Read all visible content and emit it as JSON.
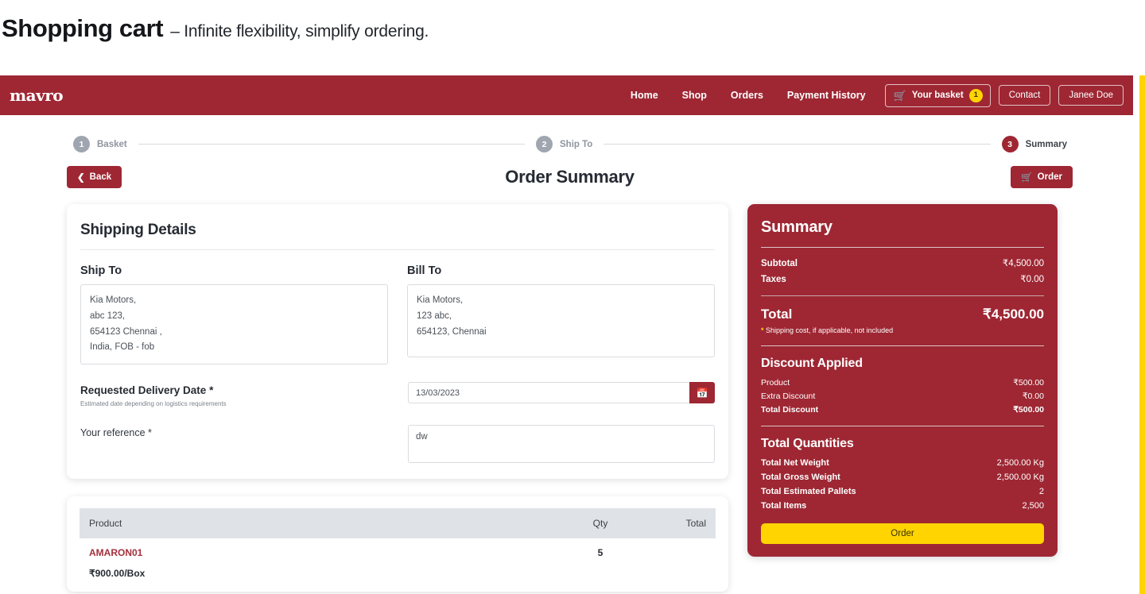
{
  "page": {
    "title": "Shopping cart",
    "subtitle": "– Infinite flexibility, simplify ordering."
  },
  "navbar": {
    "brand": "mavro",
    "links": [
      {
        "label": "Home"
      },
      {
        "label": "Shop"
      },
      {
        "label": "Orders"
      },
      {
        "label": "Payment History"
      }
    ],
    "basket": {
      "label": "Your basket",
      "count": "1",
      "icon": "shopping-cart-icon"
    },
    "contact_label": "Contact",
    "user_label": "Janee Doe",
    "bg_color": "#9E2733"
  },
  "stepper": {
    "steps": [
      {
        "number": "1",
        "label": "Basket",
        "active": false
      },
      {
        "number": "2",
        "label": "Ship To",
        "active": false
      },
      {
        "number": "3",
        "label": "Summary",
        "active": true
      }
    ]
  },
  "toolbar": {
    "back_label": "Back",
    "back_icon": "chevron-left-icon",
    "page_title": "Order Summary",
    "order_label": "Order",
    "order_icon": "shopping-cart-icon"
  },
  "shipping": {
    "card_title": "Shipping Details",
    "ship_to_label": "Ship To",
    "ship_to_address": "Kia Motors,\nabc 123,\n654123 Chennai ,\nIndia, FOB - fob",
    "bill_to_label": "Bill To",
    "bill_to_address": "Kia Motors,\n123 abc,\n654123, Chennai",
    "delivery_date_label": "Requested Delivery Date *",
    "delivery_date_hint": "Estimated date depending on logistics requirements",
    "delivery_date_value": "13/03/2023",
    "calendar_icon": "calendar-icon",
    "reference_label": "Your reference *",
    "reference_value": "dw"
  },
  "products": {
    "headers": {
      "product": "Product",
      "qty": "Qty",
      "total": "Total"
    },
    "rows": [
      {
        "sku": "AMARON01",
        "price": "₹900.00/Box",
        "qty": "5"
      }
    ]
  },
  "summary": {
    "title": "Summary",
    "lines": [
      {
        "label": "Subtotal",
        "value": "₹4,500.00"
      },
      {
        "label": "Taxes",
        "value": "₹0.00"
      }
    ],
    "total_label": "Total",
    "total_value": "₹4,500.00",
    "note_star": "*",
    "note_text": " Shipping cost, if applicable, not included",
    "discount": {
      "title": "Discount Applied",
      "rows": [
        {
          "label": "Product",
          "value": "₹500.00",
          "bold": false
        },
        {
          "label": "Extra Discount",
          "value": "₹0.00",
          "bold": false
        },
        {
          "label": "Total Discount",
          "value": "₹500.00",
          "bold": true
        }
      ]
    },
    "quantities": {
      "title": "Total Quantities",
      "rows": [
        {
          "label": "Total Net Weight",
          "value": "2,500.00 Kg"
        },
        {
          "label": "Total Gross Weight",
          "value": "2,500.00 Kg"
        },
        {
          "label": "Total Estimated Pallets",
          "value": "2"
        },
        {
          "label": "Total Items",
          "value": "2,500"
        }
      ]
    },
    "order_button": "Order",
    "accent_color": "#FFD400"
  }
}
